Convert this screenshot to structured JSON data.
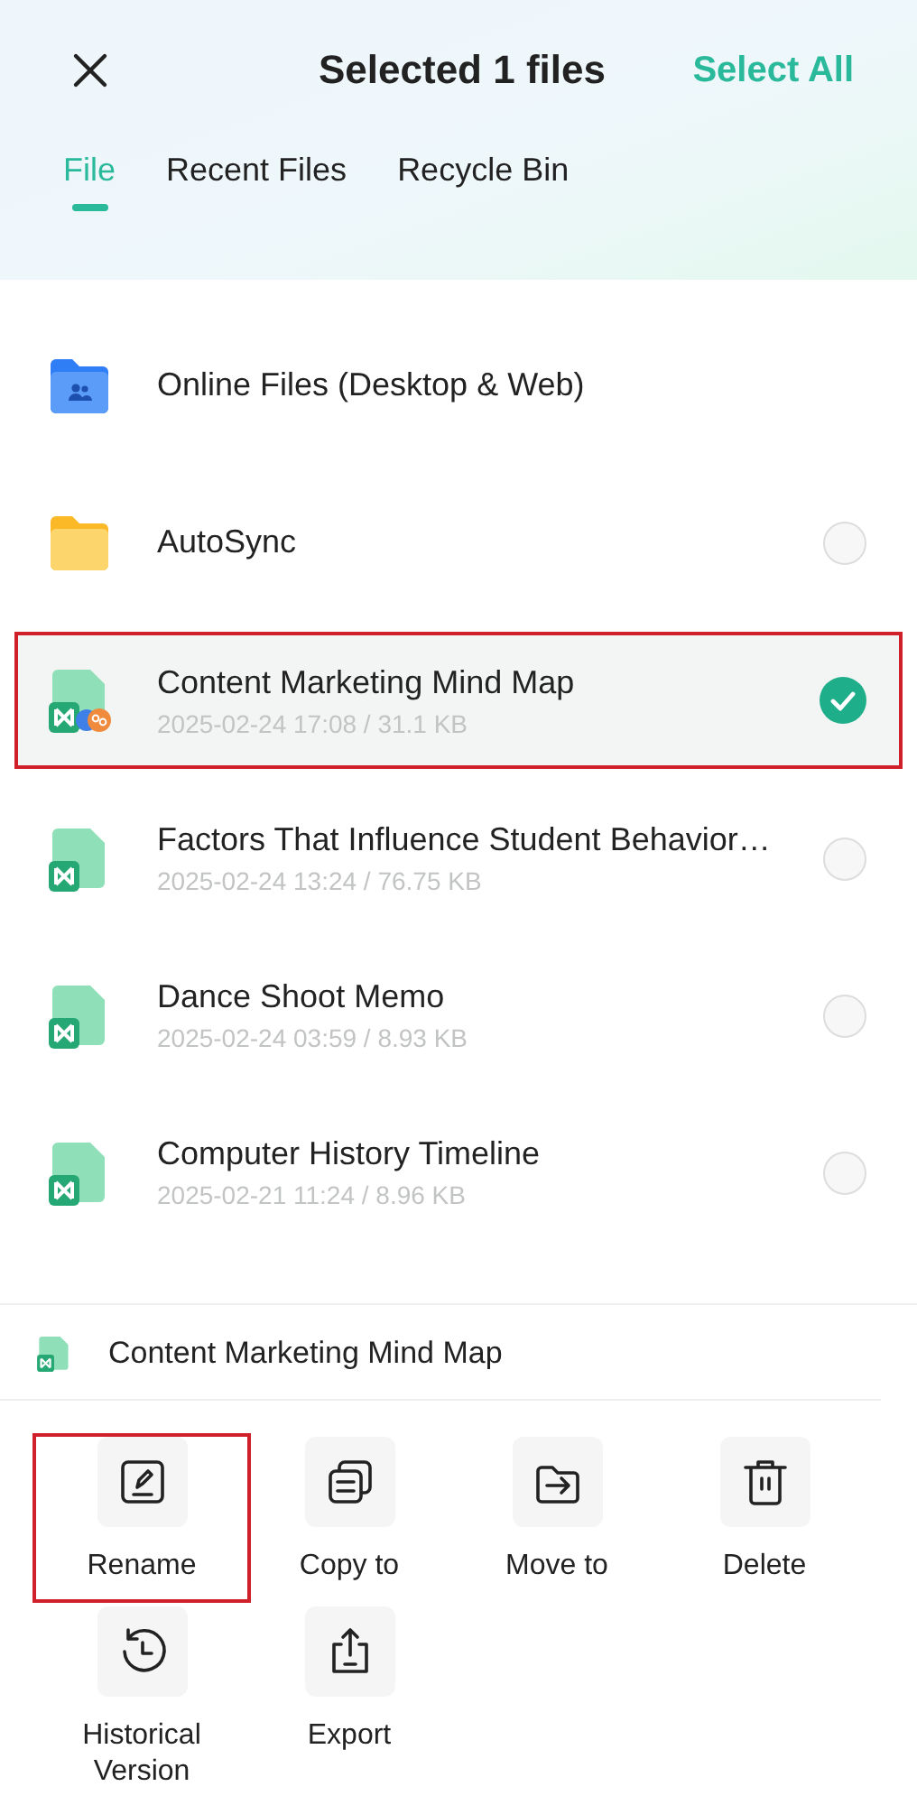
{
  "header": {
    "title": "Selected 1 files",
    "select_all": "Select All"
  },
  "tabs": [
    {
      "label": "File",
      "selected": true
    },
    {
      "label": "Recent Files",
      "selected": false
    },
    {
      "label": "Recycle Bin",
      "selected": false
    }
  ],
  "files": [
    {
      "kind": "online-folder",
      "name": "Online Files (Desktop & Web)"
    },
    {
      "kind": "folder",
      "name": "AutoSync",
      "selected": false
    },
    {
      "kind": "mindmap-shared",
      "name": "Content Marketing Mind Map",
      "meta": "2025-02-24 17:08 / 31.1 KB",
      "selected": true,
      "highlighted": true
    },
    {
      "kind": "mindmap",
      "name": "Factors That Influence Student Behavior…",
      "meta": "2025-02-24 13:24 / 76.75 KB",
      "selected": false
    },
    {
      "kind": "mindmap",
      "name": "Dance Shoot Memo",
      "meta": "2025-02-24 03:59 / 8.93 KB",
      "selected": false
    },
    {
      "kind": "mindmap",
      "name": "Computer History Timeline",
      "meta": "2025-02-21 11:24 / 8.96 KB",
      "selected": false
    }
  ],
  "sheet": {
    "title": "Content Marketing Mind Map",
    "actions": [
      {
        "kind": "rename",
        "label": "Rename",
        "highlighted": true
      },
      {
        "kind": "copy",
        "label": "Copy to",
        "highlighted": false
      },
      {
        "kind": "move",
        "label": "Move to",
        "highlighted": false
      },
      {
        "kind": "delete",
        "label": "Delete",
        "highlighted": false
      },
      {
        "kind": "history",
        "label": "Historical Version",
        "highlighted": false
      },
      {
        "kind": "export",
        "label": "Export",
        "highlighted": false
      }
    ]
  }
}
